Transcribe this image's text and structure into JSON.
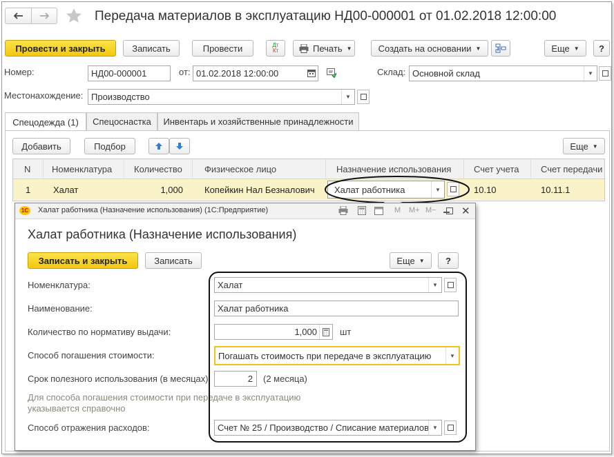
{
  "window": {
    "title": "Передача материалов в эксплуатацию НД00-000001 от 01.02.2018 12:00:00"
  },
  "toolbar": {
    "post_close": "Провести и закрыть",
    "save": "Записать",
    "post": "Провести",
    "dt_kt_top": "Дт",
    "dt_kt_bottom": "Кт",
    "print": "Печать",
    "create_based": "Создать на основании",
    "more": "Еще",
    "help": "?"
  },
  "header": {
    "number_label": "Номер:",
    "number_value": "НД00-000001",
    "date_label": "от:",
    "date_value": "01.02.2018 12:00:00",
    "warehouse_label": "Склад:",
    "warehouse_value": "Основной склад",
    "location_label": "Местонахождение:",
    "location_value": "Производство"
  },
  "tabs": [
    {
      "label": "Спецодежда (1)"
    },
    {
      "label": "Спецоснастка"
    },
    {
      "label": "Инвентарь и хозяйственные принадлежности"
    }
  ],
  "table_toolbar": {
    "add": "Добавить",
    "pick": "Подбор",
    "more": "Еще"
  },
  "table": {
    "columns": [
      "N",
      "Номенклатура",
      "Количество",
      "Физическое лицо",
      "Назначение использования",
      "Счет учета",
      "Счет передачи"
    ],
    "rows": [
      {
        "n": "1",
        "item": "Халат",
        "qty": "1,000",
        "person": "Копейкин Нал Безналович",
        "purpose": "Халат работника",
        "account": "10.10",
        "transfer": "10.11.1"
      }
    ]
  },
  "dialog": {
    "window_title": "Халат работника (Назначение использования)  (1С:Предприятие)",
    "logo": "1С",
    "title_m": "M",
    "title_mplus": "M+",
    "title_mminus": "M−",
    "heading": "Халат работника (Назначение использования)",
    "save_close": "Записать и закрыть",
    "save": "Записать",
    "more": "Еще",
    "help": "?",
    "nomenclature_label": "Номенклатура:",
    "nomenclature_value": "Халат",
    "name_label": "Наименование:",
    "name_value": "Халат работника",
    "norm_qty_label": "Количество по нормативу выдачи:",
    "norm_qty_value": "1,000",
    "unit": "шт",
    "repay_label": "Способ погашения стоимости:",
    "repay_value": "Погашать стоимость при передаче в эксплуатацию",
    "term_label": "Срок полезного использования (в месяцах):",
    "term_value": "2",
    "term_hint": "(2 месяца)",
    "note_line1": "Для способа погашения стоимости при передаче в эксплуатацию",
    "note_line2": "указывается справочно",
    "expense_label": "Способ отражения расходов:",
    "expense_value": "Счет № 25 / Производство / Списание материалов"
  }
}
